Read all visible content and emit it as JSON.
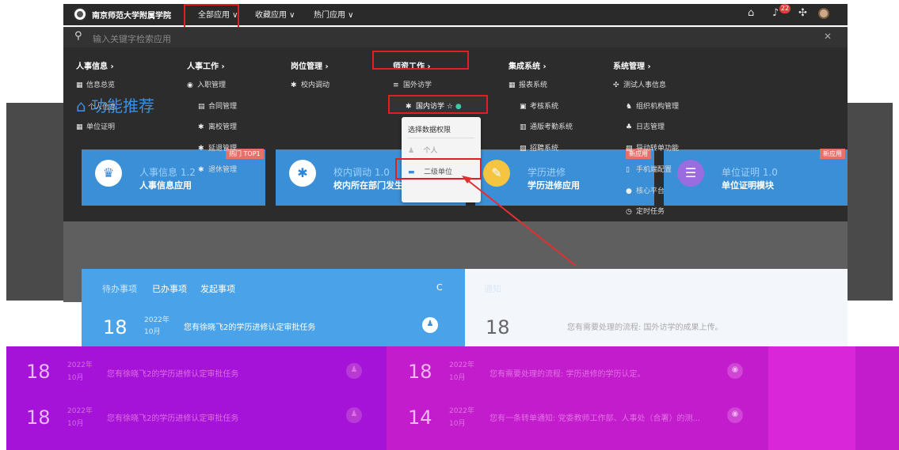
{
  "topbar": {
    "school": "南京师范大学附属学院",
    "nav": [
      {
        "label": "全部应用 ∨"
      },
      {
        "label": "收藏应用 ∨"
      },
      {
        "label": "热门应用 ∨"
      }
    ],
    "badge_count": "22"
  },
  "search": {
    "placeholder": "输入关键字检索应用"
  },
  "menu": {
    "columns": [
      {
        "head": "人事信息 ›",
        "items": [
          "信息总览",
          "个人信息",
          "单位证明"
        ]
      },
      {
        "head": "人事工作 ›",
        "items": [
          "入职管理",
          "合同管理",
          "离校管理",
          "延退管理",
          "退休管理"
        ]
      },
      {
        "head": "岗位管理 ›",
        "items": [
          "校内调动"
        ]
      },
      {
        "head": "师资工作 ›",
        "items": [
          "国外访学",
          "国内访学"
        ]
      },
      {
        "head": "集成系统 ›",
        "items": [
          "报表系统",
          "考核系统",
          "通版考勤系统",
          "招聘系统",
          "手机端配置"
        ]
      },
      {
        "head": "系统管理 ›",
        "items": [
          "测试人事信息",
          "组织机构管理",
          "日志管理",
          "导动转单功能",
          "核心平台",
          "定时任务"
        ]
      }
    ],
    "new_tag": "新应用"
  },
  "permission": {
    "title": "选择数据权限",
    "options": [
      "个人",
      "二级单位"
    ]
  },
  "recommend": {
    "title": "功能推荐",
    "hot_tag": "热门 TOP1",
    "new_tag": "新应用",
    "cards": [
      {
        "name": "人事信息 1.2",
        "desc": "人事信息应用",
        "icon": "people-icon"
      },
      {
        "name": "校内调动 1.0",
        "desc": "校内所在部门发生变动",
        "icon": "walk-icon"
      },
      {
        "name": "学历进修",
        "desc": "学历进修应用",
        "icon": "note-icon"
      },
      {
        "name": "单位证明 1.0",
        "desc": "单位证明模块",
        "icon": "doc-icon"
      }
    ]
  },
  "todo": {
    "tabs": [
      "待办事项",
      "已办事项",
      "发起事项"
    ],
    "refresh": "C",
    "notice_tab": "通知",
    "rows_left": [
      {
        "day": "18",
        "year": "2022年",
        "month": "10月",
        "title": "您有徐晓飞2的学历进修认定审批任务"
      },
      {
        "day": "18",
        "year": "2022年",
        "month": "10月",
        "title": "您有徐晓飞2的学历进修认定审批任务"
      },
      {
        "day": "18",
        "year": "2022年",
        "month": "10月",
        "title": "您有徐晓飞2的学历进修认定审批任务"
      }
    ],
    "rows_right": [
      {
        "day": "18",
        "year": "",
        "month": "",
        "title": "您有需要处理的流程: 国外访学的成果上传。"
      },
      {
        "day": "18",
        "year": "2022年",
        "month": "10月",
        "title": "您有需要处理的流程: 学历进修的学历认定。"
      },
      {
        "day": "14",
        "year": "2022年",
        "month": "10月",
        "title": "您有一条转单通知: 党委教师工作部、人事处（合署）的测..."
      }
    ]
  },
  "colors": {
    "accent": "#3a8fd6",
    "highlight": "#e02020",
    "magenta": "#c21ccc"
  }
}
